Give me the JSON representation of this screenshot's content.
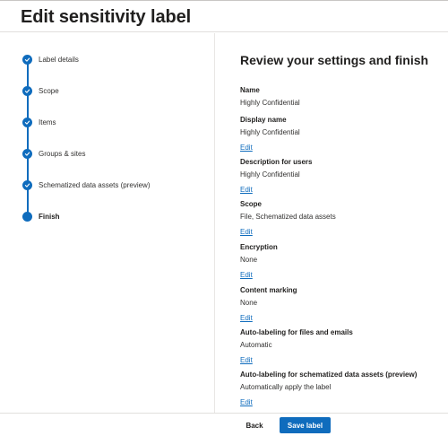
{
  "header": {
    "title": "Edit sensitivity label"
  },
  "wizard": {
    "steps": [
      {
        "label": "Label details",
        "state": "completed"
      },
      {
        "label": "Scope",
        "state": "completed"
      },
      {
        "label": "Items",
        "state": "completed"
      },
      {
        "label": "Groups & sites",
        "state": "completed"
      },
      {
        "label": "Schematized data assets (preview)",
        "state": "completed"
      },
      {
        "label": "Finish",
        "state": "current"
      }
    ]
  },
  "review": {
    "heading": "Review your settings and finish",
    "sections": [
      {
        "title": "Name",
        "value": "Highly Confidential"
      },
      {
        "title": "Display name",
        "value": "Highly Confidential",
        "edit": "Edit"
      },
      {
        "title": "Description for users",
        "value": "Highly Confidential",
        "edit": "Edit"
      },
      {
        "title": "Scope",
        "value": "File, Schematized data assets",
        "edit": "Edit"
      },
      {
        "title": "Encryption",
        "value": "None",
        "edit": "Edit"
      },
      {
        "title": "Content marking",
        "value": "None",
        "edit": "Edit"
      },
      {
        "title": "Auto-labeling for files and emails",
        "value": "Automatic",
        "edit": "Edit"
      },
      {
        "title": "Auto-labeling for schematized data assets (preview)",
        "value": "Automatically apply the label",
        "edit": "Edit"
      }
    ]
  },
  "footer": {
    "back_label": "Back",
    "save_label": "Save label"
  },
  "colors": {
    "accent": "#0f6cbd",
    "text": "#323130",
    "divider": "#e1dfdd"
  },
  "icons": {
    "completed_step": "checkmark-icon",
    "current_step": "filled-circle-icon"
  }
}
